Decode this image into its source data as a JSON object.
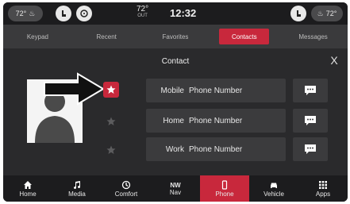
{
  "status_bar": {
    "left_temp": "72°",
    "clock": "12:32",
    "outside_temp": "72°",
    "outside_label": "OUT",
    "right_temp": "72°"
  },
  "tabs": [
    {
      "label": "Keypad",
      "active": false
    },
    {
      "label": "Recent",
      "active": false
    },
    {
      "label": "Favorites",
      "active": false
    },
    {
      "label": "Contacts",
      "active": true
    },
    {
      "label": "Messages",
      "active": false
    }
  ],
  "contact": {
    "title": "Contact",
    "close_label": "X",
    "numbers": [
      {
        "type": "Mobile",
        "value": "Phone Number",
        "favorite": true
      },
      {
        "type": "Home",
        "value": "Phone Number",
        "favorite": false
      },
      {
        "type": "Work",
        "value": "Phone Number",
        "favorite": false
      }
    ]
  },
  "bottom_nav": [
    {
      "label": "Home",
      "icon": "home-icon",
      "active": false
    },
    {
      "label": "Media",
      "icon": "music-note-icon",
      "active": false
    },
    {
      "label": "Comfort",
      "icon": "comfort-icon",
      "active": false
    },
    {
      "label": "Nav",
      "icon": "compass-nw-icon",
      "compass": "NW",
      "active": false
    },
    {
      "label": "Phone",
      "icon": "phone-icon",
      "active": true
    },
    {
      "label": "Vehicle",
      "icon": "car-icon",
      "active": false
    },
    {
      "label": "Apps",
      "icon": "apps-grid-icon",
      "active": false
    }
  ],
  "colors": {
    "accent": "#c8283c",
    "background": "#2a2a2c"
  }
}
